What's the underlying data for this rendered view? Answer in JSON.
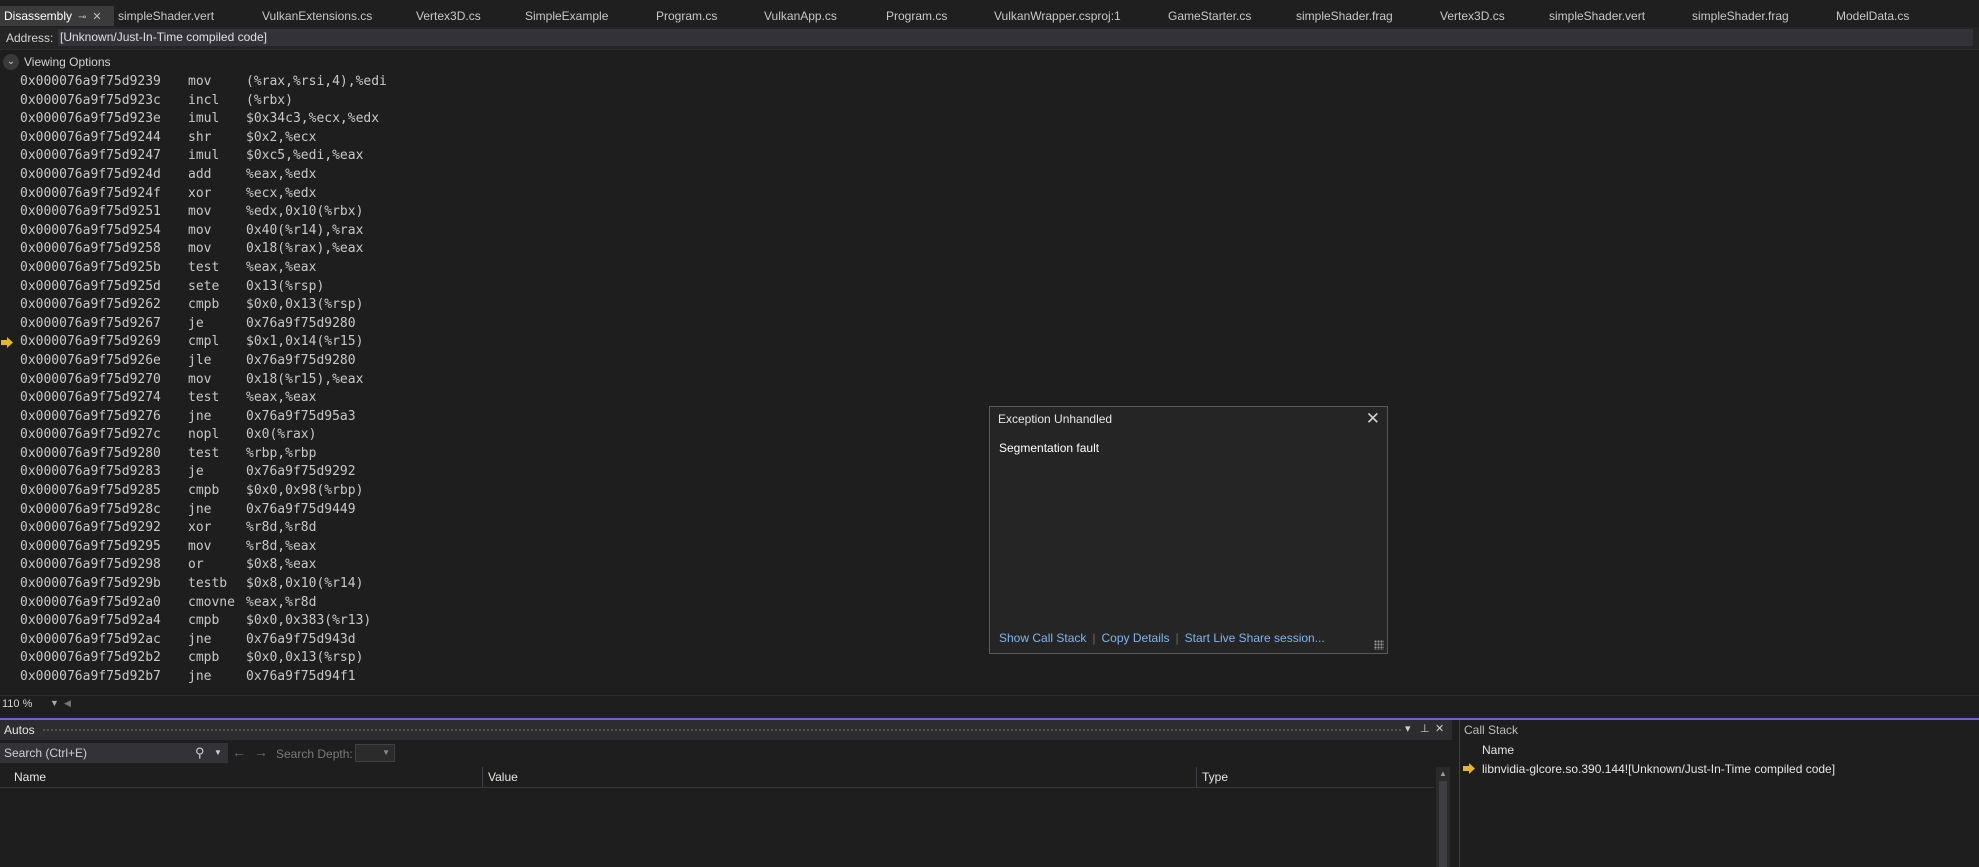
{
  "tabs": [
    {
      "label": "Disassembly",
      "active": true
    },
    {
      "label": "simpleShader.vert"
    },
    {
      "label": "VulkanExtensions.cs"
    },
    {
      "label": "Vertex3D.cs"
    },
    {
      "label": "SimpleExample"
    },
    {
      "label": "Program.cs"
    },
    {
      "label": "VulkanApp.cs"
    },
    {
      "label": "Program.cs"
    },
    {
      "label": "VulkanWrapper.csproj:1"
    },
    {
      "label": "GameStarter.cs"
    },
    {
      "label": "simpleShader.frag"
    },
    {
      "label": "Vertex3D.cs"
    },
    {
      "label": "simpleShader.vert"
    },
    {
      "label": "simpleShader.frag"
    },
    {
      "label": "ModelData.cs"
    }
  ],
  "address": {
    "label": "Address:",
    "value": "[Unknown/Just-In-Time compiled code]"
  },
  "viewing_options": {
    "label": "Viewing Options"
  },
  "instructions": [
    {
      "addr": "0x000076a9f75d9239",
      "mnemonic": "mov",
      "operands": "(%rax,%rsi,4),%edi"
    },
    {
      "addr": "0x000076a9f75d923c",
      "mnemonic": "incl",
      "operands": "(%rbx)"
    },
    {
      "addr": "0x000076a9f75d923e",
      "mnemonic": "imul",
      "operands": "$0x34c3,%ecx,%edx"
    },
    {
      "addr": "0x000076a9f75d9244",
      "mnemonic": "shr",
      "operands": "$0x2,%ecx"
    },
    {
      "addr": "0x000076a9f75d9247",
      "mnemonic": "imul",
      "operands": "$0xc5,%edi,%eax"
    },
    {
      "addr": "0x000076a9f75d924d",
      "mnemonic": "add",
      "operands": "%eax,%edx"
    },
    {
      "addr": "0x000076a9f75d924f",
      "mnemonic": "xor",
      "operands": "%ecx,%edx"
    },
    {
      "addr": "0x000076a9f75d9251",
      "mnemonic": "mov",
      "operands": "%edx,0x10(%rbx)"
    },
    {
      "addr": "0x000076a9f75d9254",
      "mnemonic": "mov",
      "operands": "0x40(%r14),%rax"
    },
    {
      "addr": "0x000076a9f75d9258",
      "mnemonic": "mov",
      "operands": "0x18(%rax),%eax"
    },
    {
      "addr": "0x000076a9f75d925b",
      "mnemonic": "test",
      "operands": "%eax,%eax"
    },
    {
      "addr": "0x000076a9f75d925d",
      "mnemonic": "sete",
      "operands": "0x13(%rsp)"
    },
    {
      "addr": "0x000076a9f75d9262",
      "mnemonic": "cmpb",
      "operands": "$0x0,0x13(%rsp)"
    },
    {
      "addr": "0x000076a9f75d9267",
      "mnemonic": "je",
      "operands": "0x76a9f75d9280"
    },
    {
      "addr": "0x000076a9f75d9269",
      "mnemonic": "cmpl",
      "operands": "$0x1,0x14(%r15)",
      "current": true
    },
    {
      "addr": "0x000076a9f75d926e",
      "mnemonic": "jle",
      "operands": "0x76a9f75d9280"
    },
    {
      "addr": "0x000076a9f75d9270",
      "mnemonic": "mov",
      "operands": "0x18(%r15),%eax"
    },
    {
      "addr": "0x000076a9f75d9274",
      "mnemonic": "test",
      "operands": "%eax,%eax"
    },
    {
      "addr": "0x000076a9f75d9276",
      "mnemonic": "jne",
      "operands": "0x76a9f75d95a3"
    },
    {
      "addr": "0x000076a9f75d927c",
      "mnemonic": "nopl",
      "operands": "0x0(%rax)"
    },
    {
      "addr": "0x000076a9f75d9280",
      "mnemonic": "test",
      "operands": "%rbp,%rbp"
    },
    {
      "addr": "0x000076a9f75d9283",
      "mnemonic": "je",
      "operands": "0x76a9f75d9292"
    },
    {
      "addr": "0x000076a9f75d9285",
      "mnemonic": "cmpb",
      "operands": "$0x0,0x98(%rbp)"
    },
    {
      "addr": "0x000076a9f75d928c",
      "mnemonic": "jne",
      "operands": "0x76a9f75d9449"
    },
    {
      "addr": "0x000076a9f75d9292",
      "mnemonic": "xor",
      "operands": "%r8d,%r8d"
    },
    {
      "addr": "0x000076a9f75d9295",
      "mnemonic": "mov",
      "operands": "%r8d,%eax"
    },
    {
      "addr": "0x000076a9f75d9298",
      "mnemonic": "or",
      "operands": "$0x8,%eax"
    },
    {
      "addr": "0x000076a9f75d929b",
      "mnemonic": "testb",
      "operands": "$0x8,0x10(%r14)"
    },
    {
      "addr": "0x000076a9f75d92a0",
      "mnemonic": "cmovne",
      "operands": "%eax,%r8d"
    },
    {
      "addr": "0x000076a9f75d92a4",
      "mnemonic": "cmpb",
      "operands": "$0x0,0x383(%r13)"
    },
    {
      "addr": "0x000076a9f75d92ac",
      "mnemonic": "jne",
      "operands": "0x76a9f75d943d"
    },
    {
      "addr": "0x000076a9f75d92b2",
      "mnemonic": "cmpb",
      "operands": "$0x0,0x13(%rsp)"
    },
    {
      "addr": "0x000076a9f75d92b7",
      "mnemonic": "jne",
      "operands": "0x76a9f75d94f1"
    }
  ],
  "zoom": "110 %",
  "exception": {
    "title": "Exception Unhandled",
    "message": "Segmentation fault",
    "links": [
      "Show Call Stack",
      "Copy Details",
      "Start Live Share session..."
    ]
  },
  "autos": {
    "title": "Autos",
    "search_placeholder": "Search (Ctrl+E)",
    "search_depth_label": "Search Depth:",
    "columns": [
      "Name",
      "Value",
      "Type"
    ]
  },
  "call_stack": {
    "title": "Call Stack",
    "column": "Name",
    "frames": [
      "libnvidia-glcore.so.390.144![Unknown/Just-In-Time compiled code]"
    ]
  },
  "colors": {
    "accent": "#7062d8",
    "link": "#80b4ec",
    "current_ip": "#e8b430"
  },
  "icons": [
    "pin-icon",
    "close-icon",
    "chevron-down-icon",
    "search-icon",
    "arrow-right-icon"
  ]
}
